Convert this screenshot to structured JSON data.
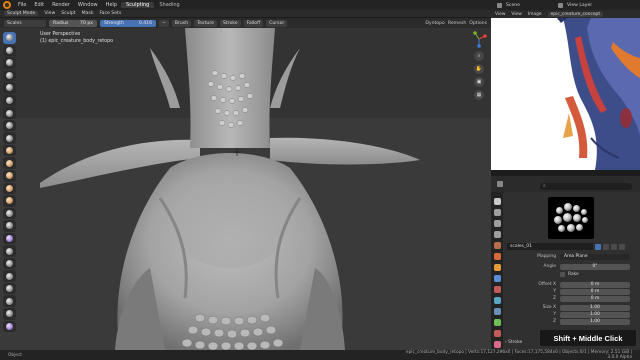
{
  "menubar": {
    "items": [
      "File",
      "Edit",
      "Render",
      "Window",
      "Help"
    ],
    "tabs": [
      {
        "label": "Sculpting",
        "active": true
      },
      {
        "label": "Shading",
        "active": false
      }
    ],
    "scene": "Scene",
    "view_layer": "View Layer"
  },
  "modebar": {
    "mode": "Sculpt Mode",
    "items": [
      "View",
      "Sculpt",
      "Mask",
      "Face Sets"
    ]
  },
  "toolheader": {
    "brush_name": "Scales",
    "radius_label": "Radius",
    "radius_value": "70 px",
    "strength_label": "Strength",
    "strength_value": "0.416",
    "menus": [
      "Brush",
      "Texture",
      "Stroke",
      "Falloff",
      "Cursor"
    ],
    "right_items": [
      "Dyntopo",
      "Remesh",
      "Options"
    ]
  },
  "viewport": {
    "view_name": "User Perspective",
    "object_name": "(1) epic_creature_body_retopo"
  },
  "right_panel": {
    "header_items": [
      "View",
      "View",
      "Image"
    ],
    "image_name": "epic_creature_concept"
  },
  "properties": {
    "texture_name": "scales_01",
    "mapping_label": "Mapping",
    "mapping_value": "Area Plane",
    "angle_label": "Angle",
    "angle_value": "0°",
    "rake_label": "Rake",
    "offset_label": "Offset X",
    "offset": [
      "0 m",
      "0 m",
      "0 m"
    ],
    "size_label": "Size X",
    "size": [
      "1.00",
      "1.00",
      "1.00"
    ],
    "axis_labels": [
      "Y",
      "Z"
    ],
    "stroke_label": "Stroke"
  },
  "overlay": {
    "key_hint": "Shift + Middle Click"
  },
  "statusbar": {
    "left": "Object",
    "right": "epic_creature_body_retopo | Verts:17,127,296x0 | Faces:17,175,584x0 | Objects:0/1 | Memory: 2.51 GiB | 3.0.0 Alpha"
  },
  "colors": {
    "accent": "#4772b3",
    "menubar_bg": "#232323",
    "viewport_bg": "#3a3a3a",
    "panel_bg": "#303030"
  }
}
